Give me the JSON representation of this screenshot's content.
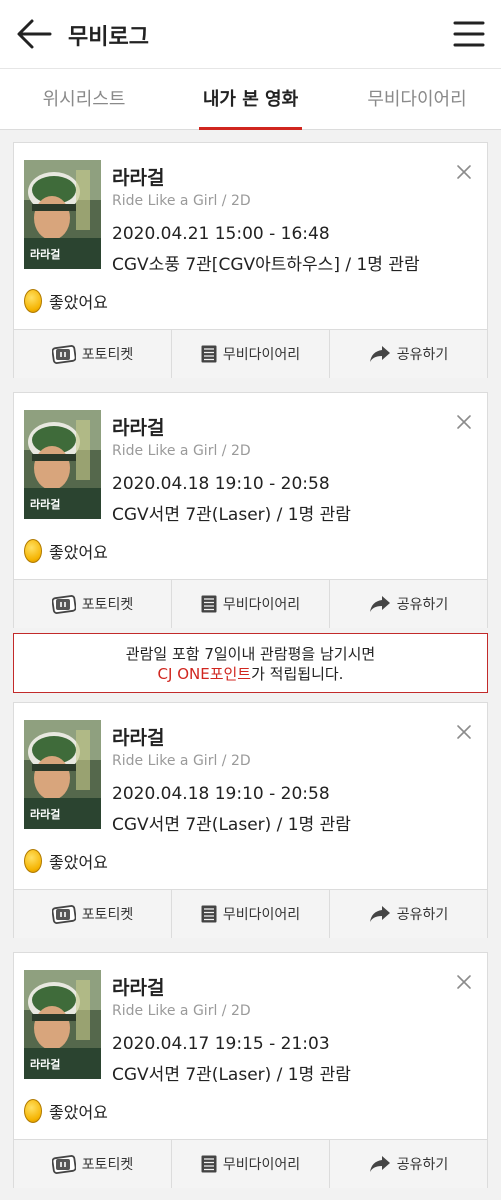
{
  "header": {
    "title": "무비로그"
  },
  "tabs": [
    {
      "label": "위시리스트"
    },
    {
      "label": "내가 본 영화"
    },
    {
      "label": "무비다이어리"
    }
  ],
  "notice": {
    "line1": "관람일 포함 7일이내 관람평을 남기시면",
    "highlight": "CJ ONE포인트",
    "line2_suffix": "가 적립됩니다."
  },
  "cards": [
    {
      "title": "라라걸",
      "subtitle": "Ride Like a Girl / 2D",
      "datetime": "2020.04.21 15:00 - 16:48",
      "theater": "CGV소풍 7관[CGV아트하우스] / 1명 관람",
      "rating": "좋았어요"
    },
    {
      "title": "라라걸",
      "subtitle": "Ride Like a Girl / 2D",
      "datetime": "2020.04.18 19:10 - 20:58",
      "theater": "CGV서면 7관(Laser) / 1명 관람",
      "rating": "좋았어요"
    },
    {
      "title": "라라걸",
      "subtitle": "Ride Like a Girl / 2D",
      "datetime": "2020.04.18 19:10 - 20:58",
      "theater": "CGV서면 7관(Laser) / 1명 관람",
      "rating": "좋았어요"
    },
    {
      "title": "라라걸",
      "subtitle": "Ride Like a Girl / 2D",
      "datetime": "2020.04.17 19:15 - 21:03",
      "theater": "CGV서면 7관(Laser) / 1명 관람",
      "rating": "좋았어요"
    }
  ],
  "actions": {
    "photo_ticket": "포토티켓",
    "movie_diary": "무비다이어리",
    "share": "공유하기"
  },
  "poster": {
    "title_text": "라라걸"
  },
  "colors": {
    "accent": "#d0261f",
    "coin": "#f5b300"
  }
}
